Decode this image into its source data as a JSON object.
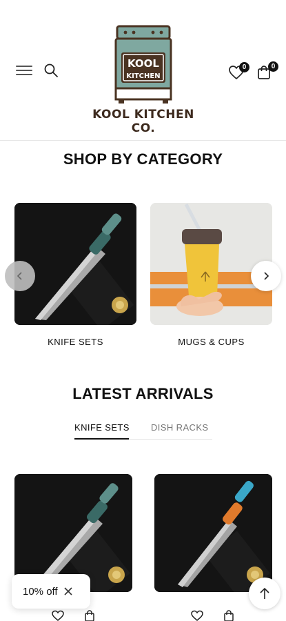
{
  "header": {
    "brand_name": "KOOL KITCHEN CO.",
    "logo_line1": "KOOL",
    "logo_line2": "KITCHEN",
    "wishlist_count": "0",
    "cart_count": "0",
    "icons": [
      "hamburger-menu-icon",
      "search-icon",
      "heart-icon",
      "shopping-bag-icon"
    ]
  },
  "categories": {
    "title": "SHOP BY CATEGORY",
    "items": [
      {
        "label": "KNIFE SETS"
      },
      {
        "label": "MUGS & CUPS"
      }
    ]
  },
  "latest": {
    "title": "LATEST ARRIVALS",
    "tabs": [
      {
        "label": "KNIFE SETS",
        "active": true
      },
      {
        "label": "DISH RACKS",
        "active": false
      }
    ]
  },
  "popup": {
    "discount_label": "10% off"
  },
  "colors": {
    "logo_teal": "#7fa8a0",
    "logo_brown": "#4a3322",
    "mug_yellow": "#f0c43a",
    "knife_box_dark": "#171717"
  }
}
